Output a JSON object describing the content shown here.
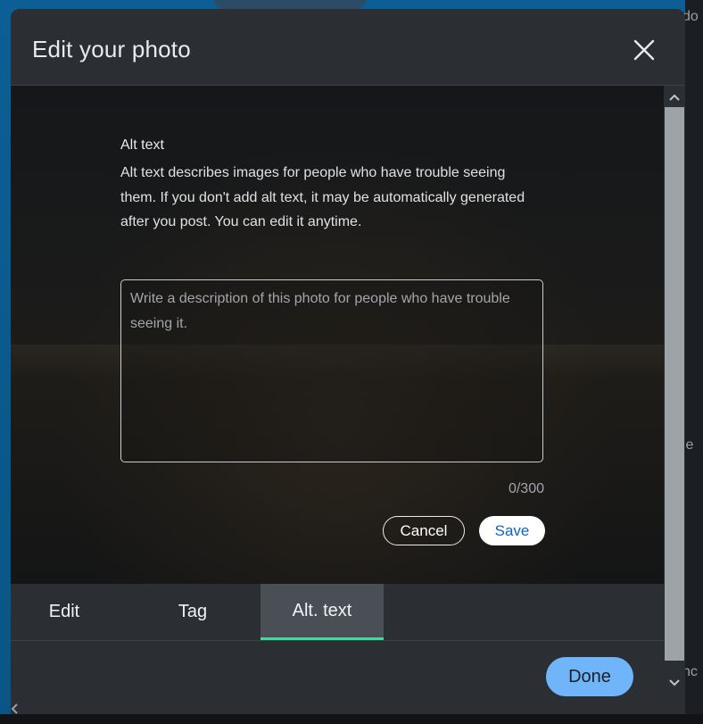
{
  "dialog": {
    "title": "Edit your photo",
    "close_icon": "close-icon"
  },
  "alt_text": {
    "label": "Alt text",
    "description": "Alt text describes images for people who have trouble seeing them. If you don't add alt text, it may be automatically generated after you post. You can edit it anytime.",
    "textarea_value": "",
    "textarea_placeholder": "Write a description of this photo for people who have trouble seeing it.",
    "char_count": "0/300",
    "cancel_label": "Cancel",
    "save_label": "Save"
  },
  "tabs": [
    {
      "label": "Edit",
      "active": false
    },
    {
      "label": "Tag",
      "active": false
    },
    {
      "label": "Alt. text",
      "active": true
    }
  ],
  "footer": {
    "done_label": "Done"
  },
  "background_glyphs": {
    "top": "do",
    "middle": "ie",
    "bottom": "hc"
  },
  "colors": {
    "accent_blue": "#70b5f9",
    "active_tab_indicator": "#3ddc97",
    "save_text": "#0a66c2",
    "dialog_bg": "#2b2f34",
    "page_bg": "#0b5f94"
  }
}
